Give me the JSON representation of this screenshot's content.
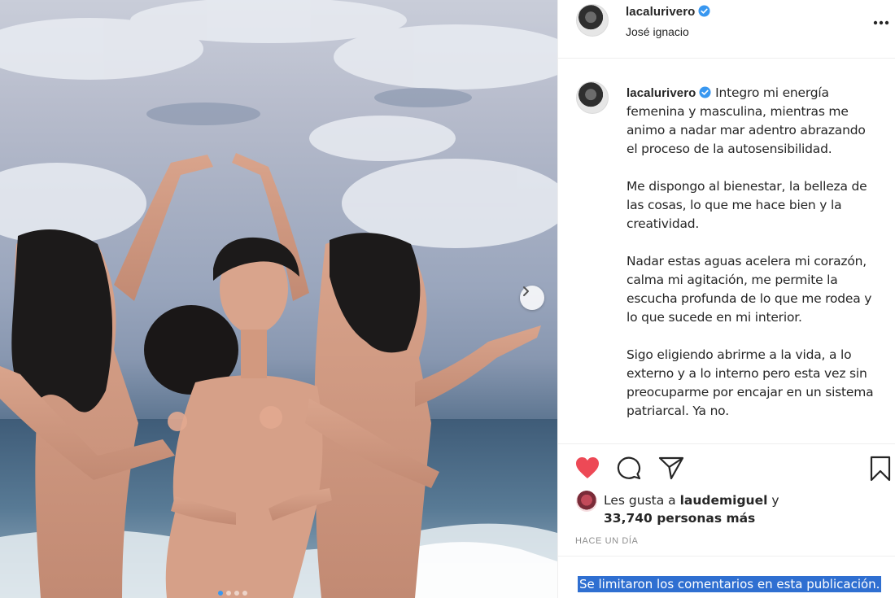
{
  "post": {
    "username": "lacalurivero",
    "location": "José ignacio",
    "more_icon": "more-horizontal-icon",
    "carousel": {
      "slide_count": 4,
      "active_index": 0,
      "next_icon": "chevron-right-icon"
    }
  },
  "caption": {
    "username": "lacalurivero",
    "paragraphs": [
      "Integro mi energía femenina y masculina, mientras me animo a nadar mar adentro abrazando el proceso de la autosensibilidad.",
      "Me dispongo al bienestar, la belleza de las cosas, lo que me hace bien y la creatividad.",
      "Nadar estas aguas acelera mi corazón, calma mi agitación, me permite la escucha profunda de lo que me rodea y lo que sucede en mi interior.",
      "Sigo eligiendo abrirme a la vida, a lo externo y a lo interno pero esta vez sin preocuparme por encajar en un sistema patriarcal. Ya no."
    ]
  },
  "actions": {
    "like_icon": "heart-filled-icon",
    "comment_icon": "comment-icon",
    "share_icon": "send-icon",
    "save_icon": "bookmark-icon",
    "like_color": "#ed4956"
  },
  "likes": {
    "prefix": "Les gusta a",
    "liker": "laudemiguel",
    "connector": "y",
    "others": "33,740 personas más"
  },
  "timestamp": "HACE UN DÍA",
  "comments_notice": "Se limitaron los comentarios en esta publicación."
}
